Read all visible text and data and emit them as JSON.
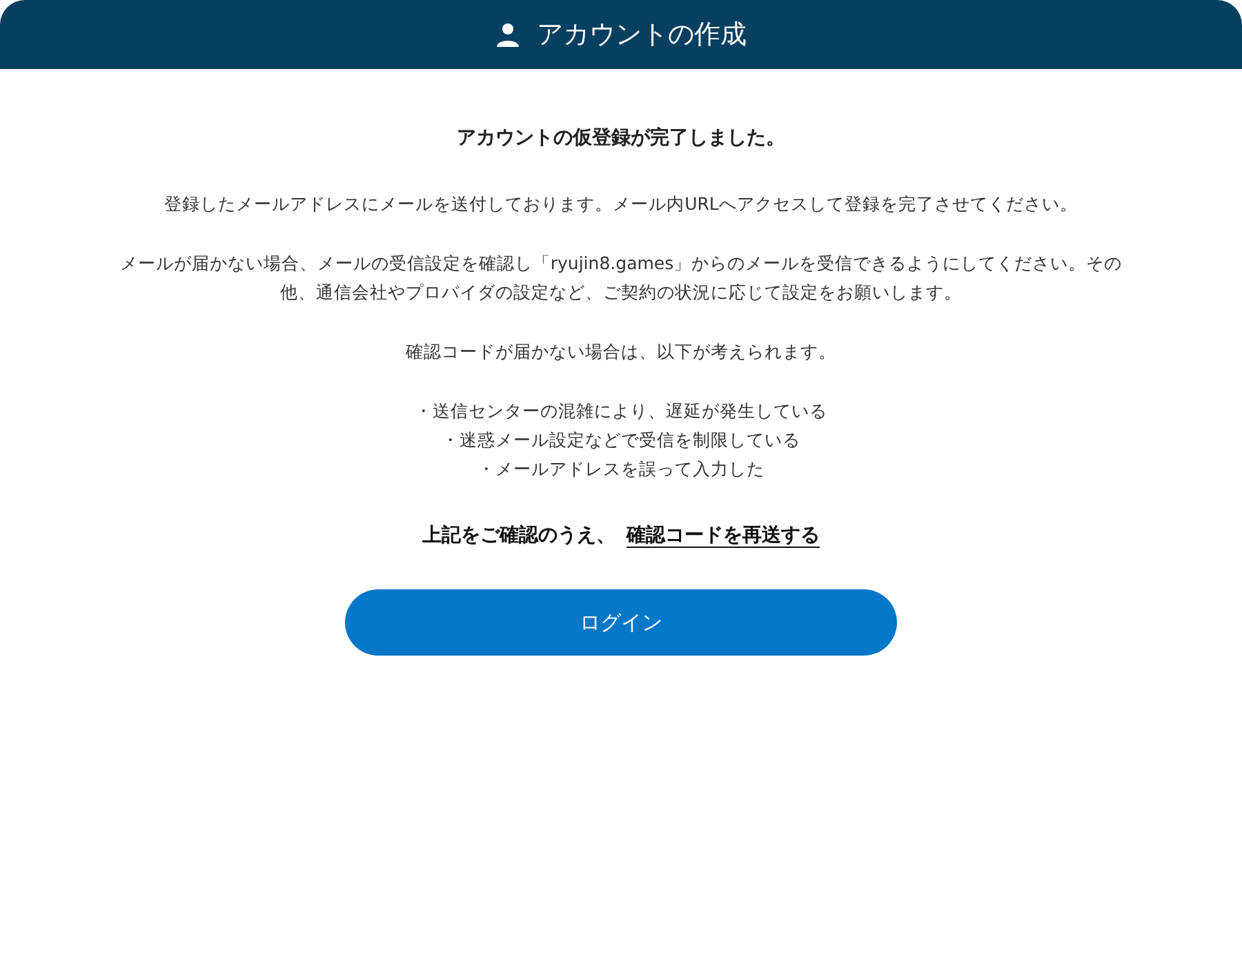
{
  "header": {
    "title": "アカウントの作成"
  },
  "heading": "アカウントの仮登録が完了しました。",
  "paragraphs": [
    "登録したメールアドレスにメールを送付しております。メール内URLへアクセスして登録を完了させてください。",
    "メールが届かない場合、メールの受信設定を確認し「ryujin8.games」からのメールを受信できるようにしてください。その他、通信会社やプロバイダの設定など、ご契約の状況に応じて設定をお願いします。",
    "確認コードが届かない場合は、以下が考えられます。"
  ],
  "reasons": [
    "・送信センターの混雑により、遅延が発生している",
    "・迷惑メール設定などで受信を制限している",
    "・メールアドレスを誤って入力した"
  ],
  "resend": {
    "prefix": "上記をご確認のうえ、",
    "link": "確認コードを再送する"
  },
  "login_button": "ログイン"
}
